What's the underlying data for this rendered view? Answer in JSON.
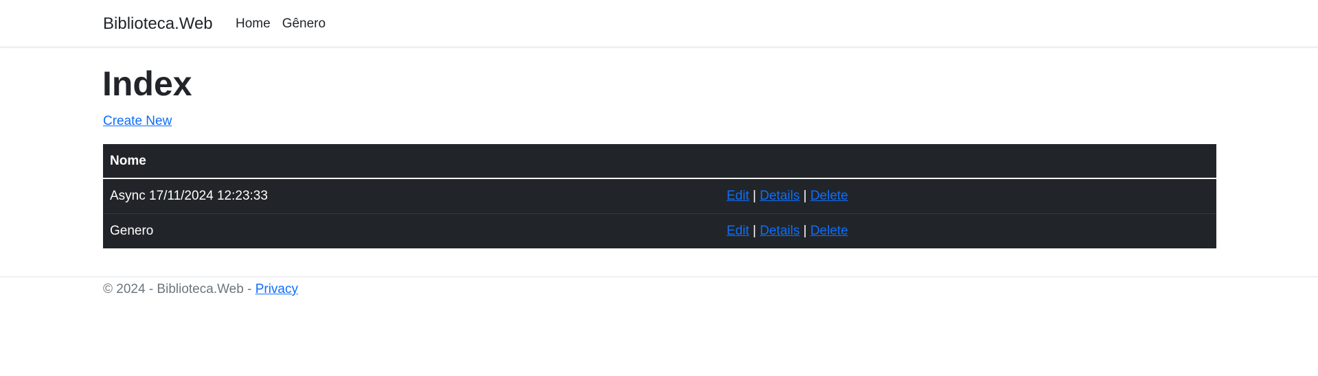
{
  "navbar": {
    "brand": "Biblioteca.Web",
    "links": [
      "Home",
      "Gênero"
    ]
  },
  "page": {
    "title": "Index",
    "create_link": "Create New"
  },
  "table": {
    "columns": [
      "Nome",
      ""
    ],
    "rows": [
      {
        "nome": "Async 17/11/2024 12:23:33",
        "actions": [
          "Edit",
          "Details",
          "Delete"
        ]
      },
      {
        "nome": "Genero",
        "actions": [
          "Edit",
          "Details",
          "Delete"
        ]
      }
    ],
    "separator": "|"
  },
  "footer": {
    "text": "© 2024 - Biblioteca.Web - ",
    "privacy_link": "Privacy"
  },
  "colors": {
    "link": "#0d6efd",
    "table_bg": "#212529",
    "muted_text": "#6c757d"
  }
}
